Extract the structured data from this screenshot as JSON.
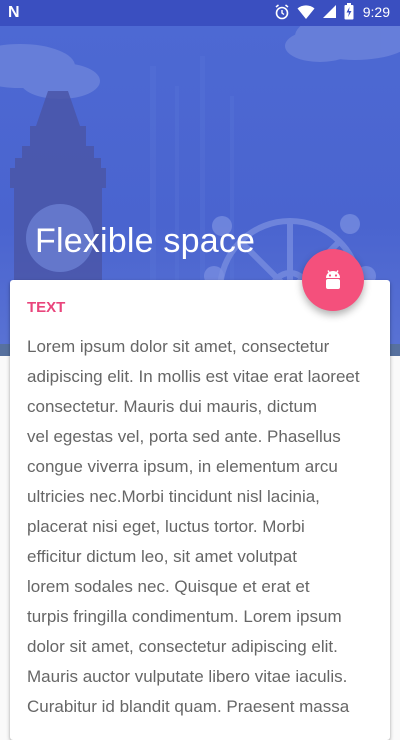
{
  "status_bar": {
    "left_icon": "n-notification-icon",
    "icons": [
      "alarm-icon",
      "wifi-icon",
      "cell-signal-icon",
      "battery-charging-icon"
    ],
    "time": "9:29",
    "background": "#3a4fc0"
  },
  "header": {
    "title": "Flexible space",
    "background": "#4d69d3"
  },
  "fab": {
    "icon": "android-icon",
    "color": "#f4507c"
  },
  "card": {
    "label": "TEXT",
    "label_color": "#e9457c",
    "lines": [
      "Lorem ipsum dolor sit amet, consectetur",
      "adipiscing elit. In mollis est vitae erat laoreet",
      "consectetur. Mauris dui mauris, dictum",
      "vel egestas vel, porta sed ante. Phasellus",
      "congue viverra ipsum, in elementum arcu",
      "ultricies nec.Morbi tincidunt nisl lacinia,",
      "placerat nisi eget, luctus tortor. Morbi",
      "efficitur dictum leo, sit amet volutpat",
      "lorem sodales nec. Quisque et erat et",
      "turpis fringilla condimentum. Lorem ipsum",
      "dolor sit amet, consectetur adipiscing elit.",
      "Mauris auctor vulputate libero vitae iaculis.",
      "Curabitur id blandit quam. Praesent massa"
    ]
  }
}
